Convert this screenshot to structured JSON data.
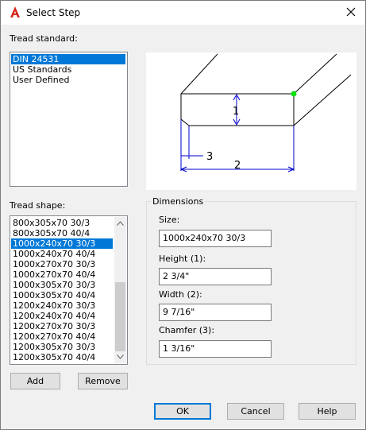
{
  "window": {
    "title": "Select Step"
  },
  "tread_standard": {
    "label": "Tread standard:",
    "items": [
      "DIN 24531",
      "US Standards",
      "User Defined"
    ],
    "selected": "DIN 24531"
  },
  "tread_shape": {
    "label": "Tread shape:",
    "items": [
      "800x305x70 30/3",
      "800x305x70 40/4",
      "1000x240x70 30/3",
      "1000x240x70 40/4",
      "1000x270x70 30/3",
      "1000x270x70 40/4",
      "1000x305x70 30/3",
      "1000x305x70 40/4",
      "1200x240x70 30/3",
      "1200x240x70 40/4",
      "1200x270x70 30/3",
      "1200x270x70 40/4",
      "1200x305x70 30/3",
      "1200x305x70 40/4"
    ],
    "selected": "1000x240x70 30/3"
  },
  "preview": {
    "dim1": "1",
    "dim2": "2",
    "dim3": "3"
  },
  "dimensions": {
    "title": "Dimensions",
    "size_label": "Size:",
    "size_value": "1000x240x70 30/3",
    "height_label": "Height (1):",
    "height_value": "2 3/4\"",
    "width_label": "Width (2):",
    "width_value": "9 7/16\"",
    "chamfer_label": "Chamfer (3):",
    "chamfer_value": "1 3/16\""
  },
  "buttons": {
    "add": "Add",
    "remove": "Remove",
    "ok": "OK",
    "cancel": "Cancel",
    "help": "Help"
  },
  "colors": {
    "selection": "#0078d7",
    "dimension_lines": "#0000cc",
    "grip": "#00e000",
    "autocad_red": "#d52b1e"
  }
}
